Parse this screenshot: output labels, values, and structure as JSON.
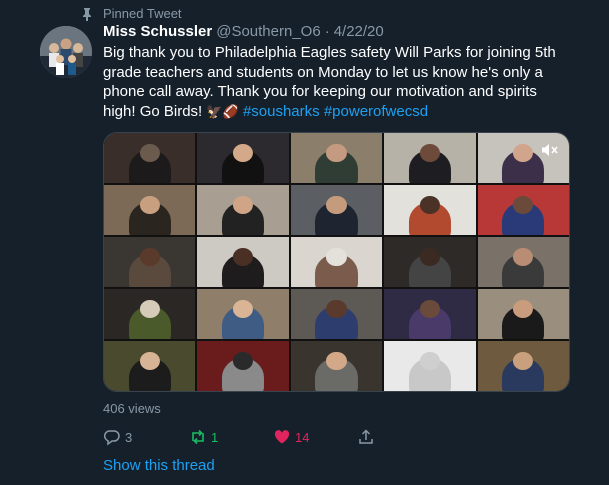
{
  "pinned": {
    "label": "Pinned Tweet",
    "icon": "pin-icon"
  },
  "tweet": {
    "author_name": "Miss Schussler",
    "handle": "@Southern_O6",
    "separator": "·",
    "date": "4/22/20",
    "text_lines": [
      "Big thank you to Philadelphia Eagles safety Will Parks for joining 5th",
      "grade teachers and students on Monday to let us know he's only a",
      "phone call away.  Thank you for keeping our motivation and spirits",
      "high! Go Birds!"
    ],
    "emojis": "🦅🏈",
    "hashtags": [
      "#sousharks",
      "#powerofwecsd"
    ],
    "views": "406 views",
    "reply_count": "3",
    "retweet_count": "1",
    "like_count": "14",
    "show_thread": "Show this thread"
  },
  "media": {
    "type": "video-grid",
    "mute_icon": "volume-mute-icon"
  },
  "colors": {
    "background": "#15202b",
    "secondary_text": "#8899a6",
    "link": "#1da1f2",
    "retweet": "#17bf63",
    "like": "#e0245e"
  }
}
